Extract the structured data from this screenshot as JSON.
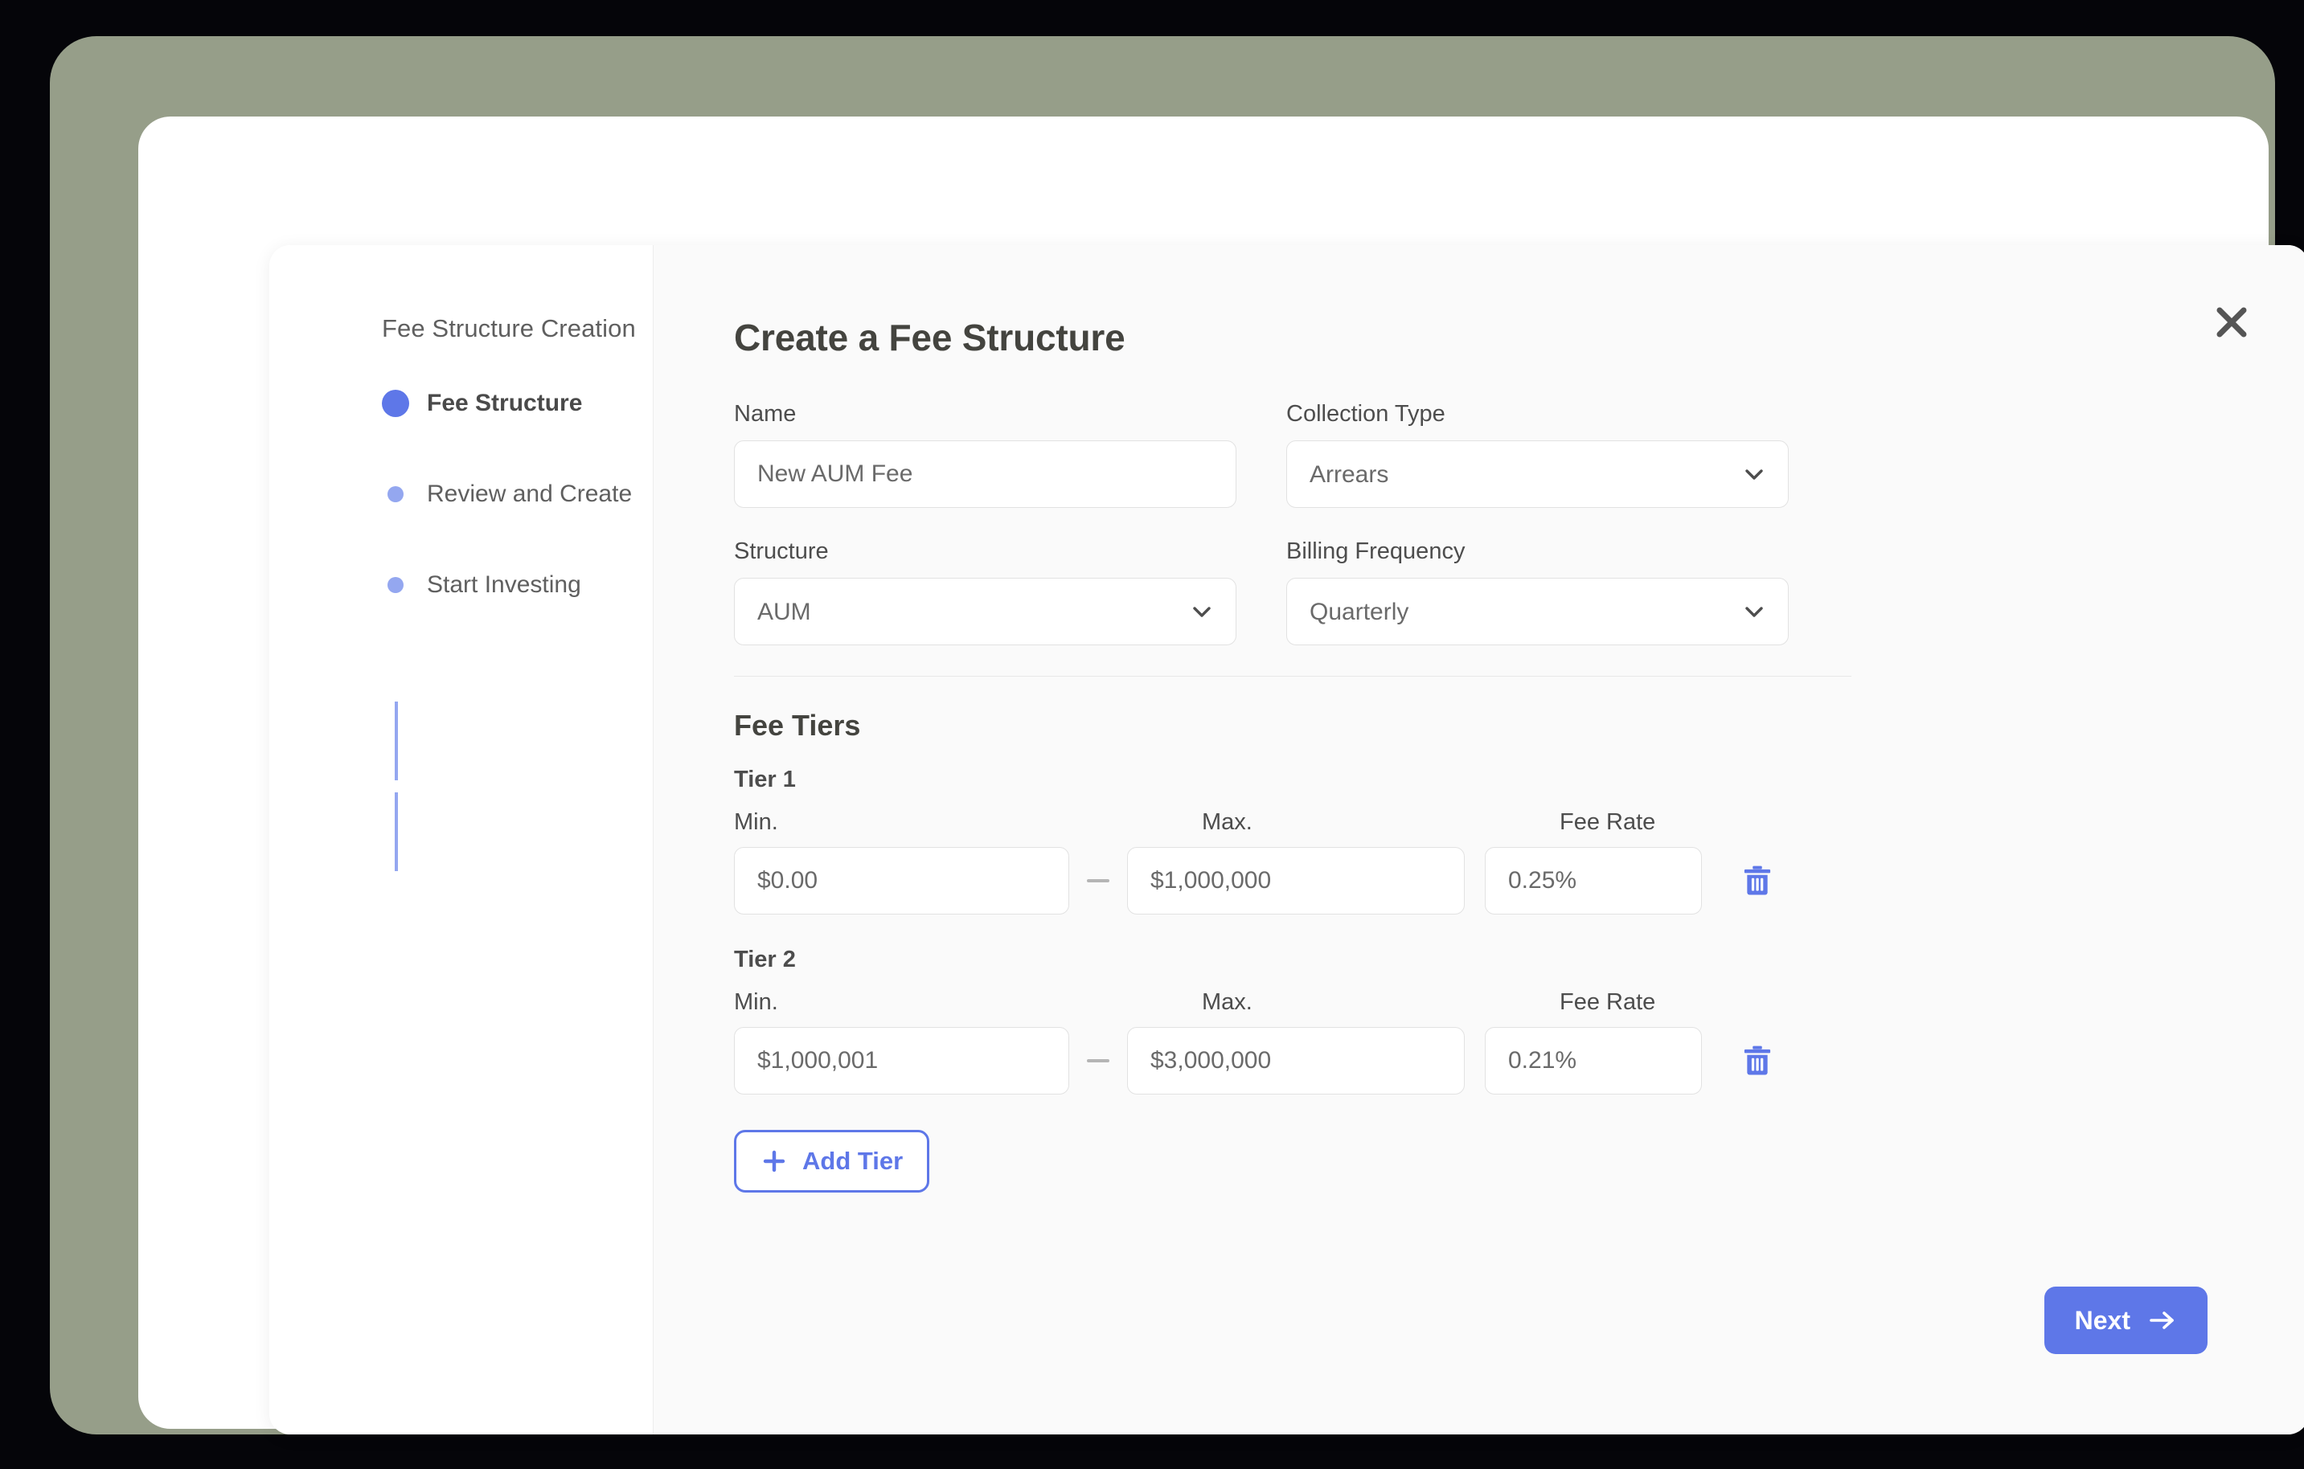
{
  "theme": {
    "accent": "#5e77e8",
    "accent_light": "#94a7f0",
    "frame": "#969e89",
    "panel_bg": "#fafafa"
  },
  "sidebar": {
    "title": "Fee Structure Creation",
    "steps": [
      {
        "label": "Fee Structure",
        "state": "active"
      },
      {
        "label": "Review and Create",
        "state": "upcoming"
      },
      {
        "label": "Start Investing",
        "state": "upcoming"
      }
    ]
  },
  "modal": {
    "title": "Create a Fee Structure",
    "close_icon": "close-icon"
  },
  "form": {
    "name": {
      "label": "Name",
      "value": "New AUM Fee",
      "placeholder": "New AUM Fee"
    },
    "collection_type": {
      "label": "Collection Type",
      "value": "Arrears",
      "options": [
        "Arrears"
      ]
    },
    "structure": {
      "label": "Structure",
      "value": "AUM",
      "options": [
        "AUM"
      ]
    },
    "billing_frequency": {
      "label": "Billing Frequency",
      "value": "Quarterly",
      "options": [
        "Quarterly"
      ]
    }
  },
  "fee_tiers": {
    "section_title": "Fee Tiers",
    "column_labels": {
      "min": "Min.",
      "max": "Max.",
      "rate": "Fee Rate"
    },
    "separator": "—",
    "tiers": [
      {
        "title": "Tier 1",
        "min": "$0.00",
        "max": "$1,000,000",
        "rate": "0.25%",
        "delete_icon": "trash-icon"
      },
      {
        "title": "Tier 2",
        "min": "$1,000,001",
        "max": "$3,000,000",
        "rate": "0.21%",
        "delete_icon": "trash-icon"
      }
    ],
    "add_tier_label": "Add Tier",
    "add_tier_icon": "plus-icon"
  },
  "footer": {
    "next_label": "Next",
    "next_icon": "arrow-right-icon"
  }
}
